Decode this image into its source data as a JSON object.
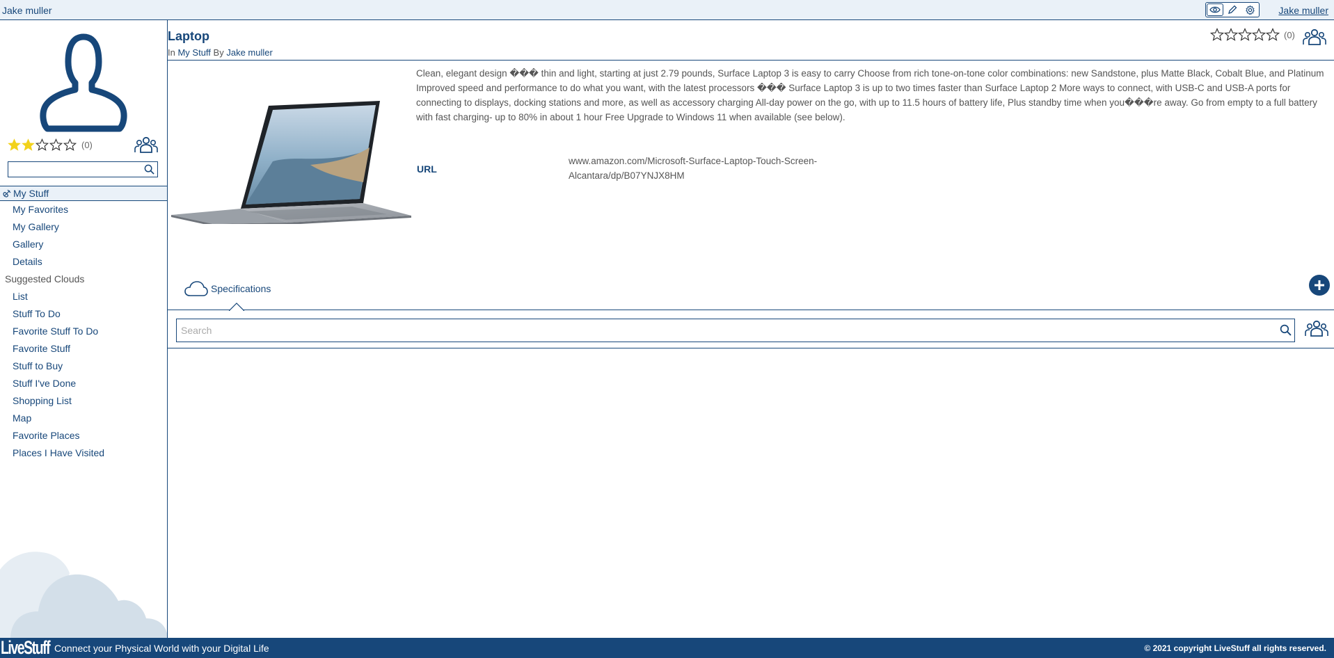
{
  "topbar": {
    "user_left": "Jake muller",
    "user_right": "Jake muller",
    "tools": [
      "eye-icon",
      "pencil-icon",
      "gear-icon"
    ]
  },
  "sidebar": {
    "rating": {
      "stars_filled": 2,
      "stars_total": 5,
      "count": "(0)"
    },
    "search": {
      "placeholder": "",
      "value": ""
    },
    "my_stuff_label": "My Stuff",
    "nav_items": [
      {
        "label": "My Favorites"
      },
      {
        "label": "My Gallery"
      },
      {
        "label": "Gallery"
      },
      {
        "label": "Details"
      }
    ],
    "suggested_heading": "Suggested Clouds",
    "suggested_items": [
      {
        "label": "List"
      },
      {
        "label": "Stuff To Do"
      },
      {
        "label": "Favorite Stuff To Do"
      },
      {
        "label": "Favorite Stuff"
      },
      {
        "label": "Stuff to Buy"
      },
      {
        "label": "Stuff I've Done"
      },
      {
        "label": "Shopping List"
      },
      {
        "label": "Map"
      },
      {
        "label": "Favorite Places"
      },
      {
        "label": "Places I Have Visited"
      }
    ]
  },
  "main": {
    "title": "Laptop",
    "sub_in": "In",
    "sub_location": "My Stuff",
    "sub_by": "By",
    "sub_author": "Jake muller",
    "rating": {
      "stars_filled": 0,
      "stars_total": 5,
      "count": "(0)"
    },
    "description": "Clean, elegant design ��� thin and light, starting at just 2.79 pounds, Surface Laptop 3 is easy to carry Choose from rich tone-on-tone color combinations: new Sandstone, plus Matte Black, Cobalt Blue, and Platinum Improved speed and performance to do what you want, with the latest processors ��� Surface Laptop 3 is up to two times faster than Surface Laptop 2 More ways to connect, with USB-C and USB-A ports for connecting to displays, docking stations and more, as well as accessory charging All-day power on the go, with up to 11.5 hours of battery life, Plus standby time when you���re away. Go from empty to a full battery with fast charging- up to 80% in about 1 hour Free Upgrade to Windows 11 when available (see below).",
    "url_label": "URL",
    "url_value": "www.amazon.com/Microsoft-Surface-Laptop-Touch-Screen-Alcantara/dp/B07YNJX8HM",
    "tab_label": "Specifications",
    "search_placeholder": "Search"
  },
  "footer": {
    "logo": "LiveStuff",
    "tagline": "Connect your Physical World with your Digital Life",
    "copyright": "© 2021 copyright LiveStuff all rights reserved."
  },
  "colors": {
    "brand": "#17477a",
    "topbar_bg": "#eaf1f8",
    "star_filled": "#f2d21b",
    "cloud": "#dde6ee"
  }
}
